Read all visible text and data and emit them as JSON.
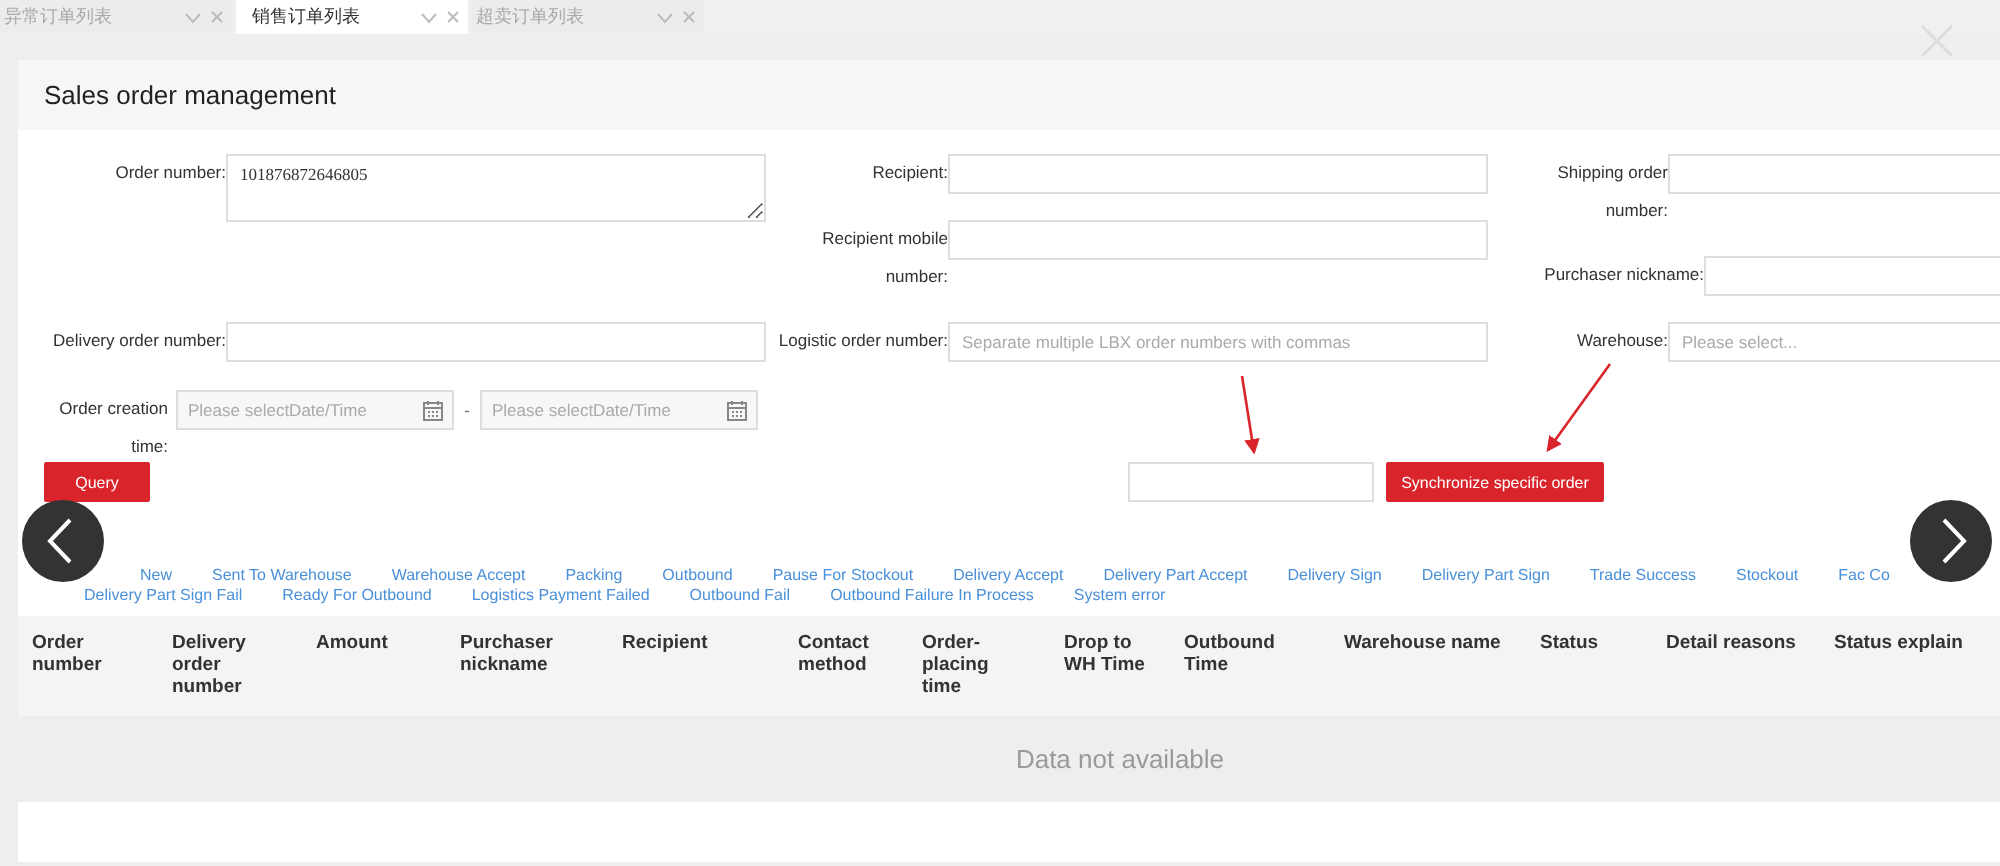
{
  "tabs": [
    {
      "label": "异常订单列表",
      "selected": false
    },
    {
      "label": "销售订单列表",
      "selected": true
    },
    {
      "label": "超卖订单列表",
      "selected": false
    }
  ],
  "title": "Sales order management",
  "form": {
    "order_number": {
      "label": "Order number:",
      "value": "101876872646805"
    },
    "recipient": {
      "label": "Recipient:"
    },
    "recipient_mobile": {
      "label": "Recipient mobile number:"
    },
    "shipping_order_number": {
      "label": "Shipping order number:"
    },
    "purchaser_nickname": {
      "label": "Purchaser nickname:"
    },
    "delivery_order_number": {
      "label": "Delivery order number:"
    },
    "logistic_order_number": {
      "label": "Logistic order number:",
      "placeholder": "Separate multiple LBX order numbers with commas"
    },
    "warehouse": {
      "label": "Warehouse:",
      "placeholder": "Please select..."
    },
    "order_creation_time": {
      "label": "Order creation time:",
      "start_placeholder": "Please selectDate/Time",
      "separator": "-",
      "end_placeholder": "Please selectDate/Time"
    },
    "query_button": "Query",
    "sync_button": "Synchronize specific order"
  },
  "status_filters": [
    "New",
    "Sent To Warehouse",
    "Warehouse Accept",
    "Packing",
    "Outbound",
    "Pause For Stockout",
    "Delivery Accept",
    "Delivery Part Accept",
    "Delivery Sign",
    "Delivery Part Sign",
    "Trade Success",
    "Stockout",
    "Fac Co",
    "Delivery Part Sign Fail",
    "Ready For Outbound",
    "Logistics Payment Failed",
    "Outbound Fail",
    "Outbound Failure In Process",
    "System error"
  ],
  "table": {
    "columns": [
      "Order number",
      "Delivery order number",
      "Amount",
      "Purchaser nickname",
      "Recipient",
      "Contact method",
      "Order-placing time",
      "Drop to WH Time",
      "Outbound Time",
      "Warehouse name",
      "Status",
      "Detail reasons",
      "Status explain"
    ],
    "empty_message": "Data not available"
  }
}
